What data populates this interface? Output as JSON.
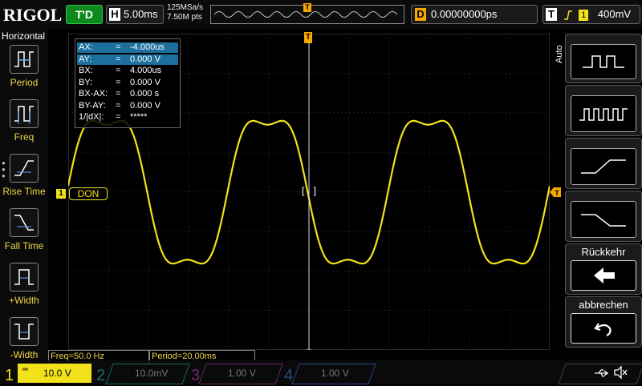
{
  "top": {
    "brand": "RIGOL",
    "trigger_status": "T'D",
    "timebase_key": "H",
    "timebase": "5.00ms",
    "sample_rate": "125MSa/s",
    "memory_points": "7.50M pts",
    "delay_key": "D",
    "delay": "0.00000000ps",
    "trigger_key": "T",
    "trigger_edge_icon": "rising-edge-icon",
    "trigger_source": "1",
    "trigger_level": "400mV",
    "trigger_position_marker": "T"
  },
  "left_menu": {
    "title": "Horizontal",
    "items": [
      {
        "label": "Period",
        "icon": "period-icon"
      },
      {
        "label": "Freq",
        "icon": "frequency-icon"
      },
      {
        "label": "Rise Time",
        "icon": "rise-time-icon"
      },
      {
        "label": "Fall Time",
        "icon": "fall-time-icon"
      },
      {
        "label": "+Width",
        "icon": "positive-width-icon"
      },
      {
        "label": "-Width",
        "icon": "negative-width-icon"
      }
    ]
  },
  "cursor": {
    "rows": [
      {
        "k": "AX:",
        "eq": "=",
        "v": "-4.000us",
        "hl": true
      },
      {
        "k": "AY:",
        "eq": "=",
        "v": "0.000 V",
        "hl": true
      },
      {
        "k": "BX:",
        "eq": "=",
        "v": "4.000us",
        "hl": false
      },
      {
        "k": "BY:",
        "eq": "=",
        "v": "0.000 V",
        "hl": false
      },
      {
        "k": "BX-AX:",
        "eq": "=",
        "v": "0.000 s",
        "hl": false
      },
      {
        "k": "BY-AY:",
        "eq": "=",
        "v": "0.000 V",
        "hl": false
      },
      {
        "k": "1/|dX|:",
        "eq": "=",
        "v": "*****",
        "hl": false
      }
    ]
  },
  "channel_label": {
    "num": "1",
    "text": "DON"
  },
  "right_menu": {
    "auto_label": "Auto",
    "buttons": [
      {
        "icon": "single-pulse-icon"
      },
      {
        "icon": "pulse-train-icon"
      },
      {
        "icon": "rising-edge-icon"
      },
      {
        "icon": "falling-edge-icon"
      }
    ],
    "back_label": "Rückkehr",
    "cancel_label": "abbrechen"
  },
  "measurements": {
    "freq": "Freq=50.0 Hz",
    "period": "Period=20.00ms"
  },
  "channels": [
    {
      "num": "1",
      "scale": "10.0 V",
      "color": "#f2e21b",
      "active": true
    },
    {
      "num": "2",
      "scale": "10.0mV",
      "color": "#1fc6b8",
      "active": false
    },
    {
      "num": "3",
      "scale": "1.00 V",
      "color": "#d23fd2",
      "active": false
    },
    {
      "num": "4",
      "scale": "1.00 V",
      "color": "#3a6fe0",
      "active": false
    }
  ],
  "status_icons": [
    "usb-icon",
    "speaker-muted-icon"
  ],
  "colors": {
    "ch1": "#f2e21b",
    "accent_orange": "#f7a800",
    "trig_green": "#0c8a1c"
  }
}
